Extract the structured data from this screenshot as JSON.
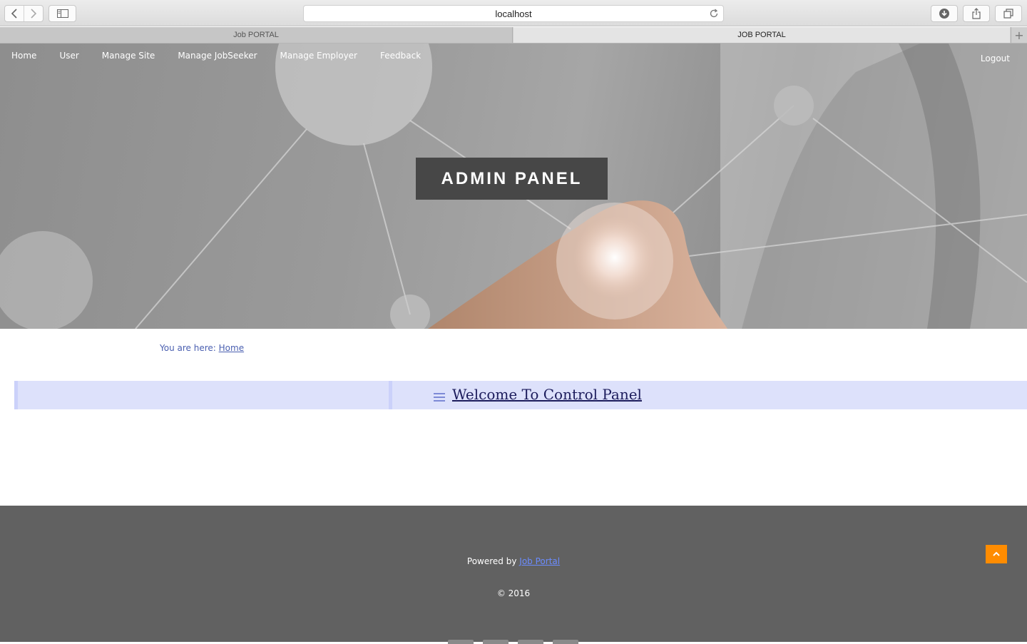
{
  "browser": {
    "url": "localhost",
    "tabs": [
      {
        "label": "Job PORTAL",
        "active": false
      },
      {
        "label": "JOB PORTAL",
        "active": true
      }
    ]
  },
  "nav": {
    "items": [
      "Home",
      "User",
      "Manage Site",
      "Manage JobSeeker",
      "Manage Employer",
      "Feedback"
    ],
    "logout": "Logout"
  },
  "hero": {
    "title": "ADMIN PANEL"
  },
  "breadcrumb": {
    "prefix": "You are here:",
    "link": "Home"
  },
  "panel": {
    "heading": "Welcome To Control Panel"
  },
  "footer": {
    "powered_prefix": "Powered by",
    "powered_link": "Job Portal",
    "copyright": "© 2016"
  },
  "colors": {
    "accent_link": "#4a5fb0",
    "panel_bg": "#dde1fb",
    "footer_bg": "#616161",
    "to_top_bg": "#ff8c00"
  }
}
